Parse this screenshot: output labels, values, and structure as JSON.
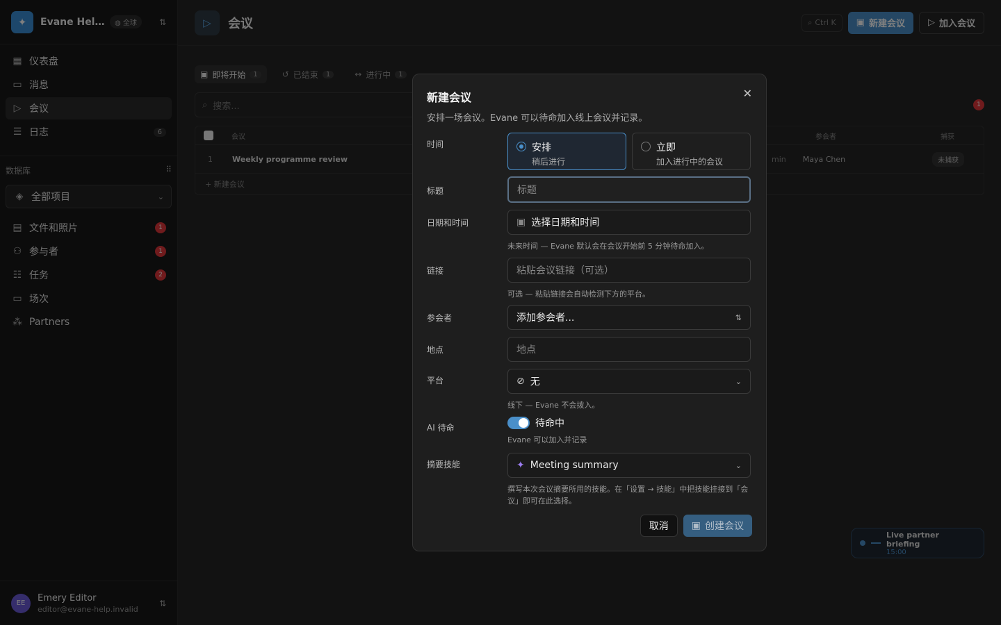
{
  "workspace": {
    "name": "Evane Help Center",
    "badge": "全球"
  },
  "nav": [
    {
      "label": "仪表盘",
      "icon": "dashboard-icon",
      "count": ""
    },
    {
      "label": "消息",
      "icon": "message-icon",
      "count": ""
    },
    {
      "label": "会议",
      "icon": "video-icon",
      "count": ""
    },
    {
      "label": "日志",
      "icon": "log-icon",
      "count": "6"
    }
  ],
  "database": {
    "heading": "数据库",
    "select_label": "全部项目",
    "items": [
      {
        "label": "文件和照片",
        "icon": "file-icon",
        "badge": "1"
      },
      {
        "label": "参与者",
        "icon": "users-icon",
        "badge": "1"
      },
      {
        "label": "任务",
        "icon": "tasks-icon",
        "badge": "2"
      },
      {
        "label": "场次",
        "icon": "session-icon",
        "badge": ""
      },
      {
        "label": "Partners",
        "icon": "partners-icon",
        "badge": ""
      }
    ]
  },
  "user": {
    "initials": "EE",
    "name": "Emery Editor",
    "email": "editor@evane-help.invalid"
  },
  "header": {
    "title": "会议",
    "search_shortcut": "Ctrl K",
    "new_meeting": "新建会议",
    "join_meeting": "加入会议"
  },
  "tabs": [
    {
      "label": "即将开始",
      "count": "1"
    },
    {
      "label": "已结束",
      "count": "1"
    },
    {
      "label": "进行中",
      "count": "1"
    }
  ],
  "list": {
    "search_placeholder": "搜索...",
    "col_meeting": "会议",
    "col_participants": "参会者",
    "col_status": "捕获",
    "row": {
      "index": "1",
      "title": "Weekly programme review",
      "duration": "min",
      "participant": "Maya Chen",
      "status": "未捕获"
    },
    "add_label": "+ 新建会议",
    "notif_count": "1"
  },
  "float_card": {
    "title": "Live partner briefing",
    "time": "15:00"
  },
  "modal": {
    "title": "新建会议",
    "description": "安排一场会议。Evane 可以待命加入线上会议并记录。",
    "time_label": "时间",
    "option_schedule": {
      "title": "安排",
      "sub": "稍后进行"
    },
    "option_now": {
      "title": "立即",
      "sub": "加入进行中的会议"
    },
    "title_label": "标题",
    "title_placeholder": "标题",
    "datetime_label": "日期和时间",
    "datetime_placeholder": "选择日期和时间",
    "datetime_hint": "未来时间 — Evane 默认会在会议开始前 5 分钟待命加入。",
    "link_label": "链接",
    "link_placeholder": "粘贴会议链接（可选）",
    "link_hint": "可选 — 粘贴链接会自动检测下方的平台。",
    "attendees_label": "参会者",
    "attendees_placeholder": "添加参会者...",
    "location_label": "地点",
    "location_placeholder": "地点",
    "platform_label": "平台",
    "platform_value": "无",
    "platform_hint": "线下 — Evane 不会拨入。",
    "ai_label": "AI 待命",
    "ai_value": "待命中",
    "ai_hint": "Evane 可以加入并记录",
    "skill_label": "摘要技能",
    "skill_value": "Meeting summary",
    "skill_hint": "撰写本次会议摘要所用的技能。在「设置 → 技能」中把技能挂接到「会议」即可在此选择。",
    "cancel": "取消",
    "create": "创建会议"
  }
}
